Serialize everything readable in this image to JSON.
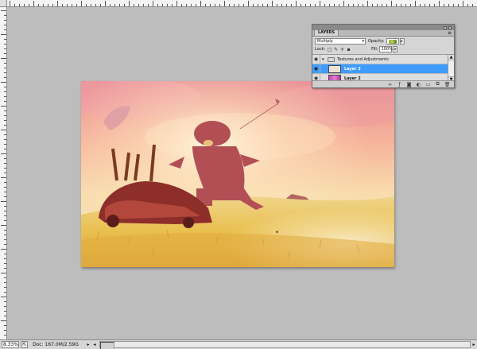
{
  "panel": {
    "tab_label": "LAYERS",
    "menu_icon": "panel-menu-icon",
    "blend_mode": "Multiply",
    "opacity_label": "Opacity:",
    "lock_label": "Lock:",
    "fill_label": "Fill:",
    "fill_value": "100%",
    "layers": [
      {
        "name": "Textures and Adjustments",
        "type": "group"
      },
      {
        "name": "Layer 3",
        "selected": true
      },
      {
        "name": "Layer 2"
      },
      {
        "name": ""
      }
    ],
    "footer_icons": [
      "link-layers-icon",
      "fx-icon",
      "layer-mask-icon",
      "adjustment-layer-icon",
      "new-group-icon",
      "new-layer-icon",
      "delete-layer-icon"
    ]
  },
  "status": {
    "zoom": "8.33%",
    "doc_info": "Doc: 167.0M/2.59G"
  },
  "colors": {
    "selection": "#3f9cff",
    "workspace": "#bdbdbd",
    "panel_bg": "#d5d5d5"
  }
}
